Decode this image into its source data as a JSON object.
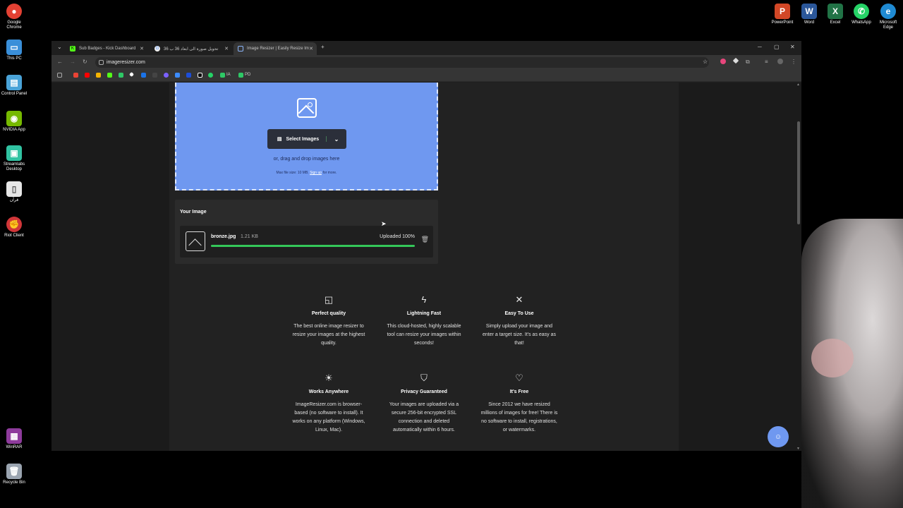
{
  "desktop": {
    "left_icons": [
      {
        "label": "Google Chrome",
        "icon": "chrome-icon",
        "color": "#e34133"
      },
      {
        "label": "This PC",
        "icon": "monitor-icon",
        "color": "#3a8fd9"
      },
      {
        "label": "Control Panel",
        "icon": "control-panel-icon",
        "color": "#4aa3d8"
      },
      {
        "label": "NVIDIA App",
        "icon": "nvidia-icon",
        "color": "#76b900"
      },
      {
        "label": "Streamlabs Desktop",
        "icon": "streamlabs-icon",
        "color": "#31c3a2"
      },
      {
        "label": "قرآن",
        "icon": "file-icon",
        "color": "#e6e6e6"
      },
      {
        "label": "Riot Client",
        "icon": "riot-icon",
        "color": "#d13639"
      },
      {
        "label": "WinRAR",
        "icon": "winrar-icon",
        "color": "#8e3b9c"
      },
      {
        "label": "Recycle Bin",
        "icon": "recycle-bin-icon",
        "color": "#9aa4b0"
      }
    ],
    "right_icons": [
      {
        "label": "PowerPoint",
        "icon": "powerpoint-icon",
        "color": "#d24726",
        "glyph": "P"
      },
      {
        "label": "Word",
        "icon": "word-icon",
        "color": "#2b579a",
        "glyph": "W"
      },
      {
        "label": "Excel",
        "icon": "excel-icon",
        "color": "#217346",
        "glyph": "X"
      },
      {
        "label": "WhatsApp",
        "icon": "whatsapp-icon",
        "color": "#25d366",
        "glyph": "✆"
      },
      {
        "label": "Microsoft Edge",
        "icon": "edge-icon",
        "color": "#1f8ad2",
        "glyph": "e"
      }
    ]
  },
  "browser": {
    "tabs": [
      {
        "title": "Sub Badges - Kick Dashboard",
        "favicon": "kick-icon",
        "active": false
      },
      {
        "title": "تحويل صورة الى ابعاد 36 ب 36",
        "favicon": "google-icon",
        "active": false
      },
      {
        "title": "Image Resizer | Easily Resize Im",
        "favicon": "image-resizer-icon",
        "active": true
      }
    ],
    "new_tab": "+",
    "url": "imageresizer.com",
    "bookmarks": [
      {
        "label": "IA"
      },
      {
        "label": "PD"
      }
    ]
  },
  "upload": {
    "select_label": "Select Images",
    "drag_hint": "or, drag and drop images here",
    "size_prefix": "Max file size: 10 MB.",
    "sign_up": "Sign up",
    "size_suffix": "for more."
  },
  "your_image": {
    "title": "Your Image",
    "file_name": "bronze.jpg",
    "file_size": "1.21 KB",
    "status": "Uploaded 100%",
    "progress": 1.0
  },
  "features": [
    {
      "icon": "image-quality-icon",
      "glyph": "◱",
      "title": "Perfect quality",
      "desc": "The best online image resizer to resize your images at the highest quality."
    },
    {
      "icon": "lightning-icon",
      "glyph": "ϟ",
      "title": "Lightning Fast",
      "desc": "This cloud-hosted, highly scalable tool can resize your images within seconds!"
    },
    {
      "icon": "tools-icon",
      "glyph": "✕",
      "title": "Easy To Use",
      "desc": "Simply upload your image and enter a target size. It's as easy as that!"
    },
    {
      "icon": "lightbulb-icon",
      "glyph": "☀",
      "title": "Works Anywhere",
      "desc": "ImageResizer.com is browser-based (no software to install). It works on any platform (Windows, Linux, Mac)."
    },
    {
      "icon": "shield-icon",
      "glyph": "⛉",
      "title": "Privacy Guaranteed",
      "desc": "Your images are uploaded via a secure 256-bit encrypted SSL connection and deleted automatically within 6 hours."
    },
    {
      "icon": "heart-icon",
      "glyph": "♡",
      "title": "It's Free",
      "desc": "Since 2012 we have resized millions of images for free! There is no software to install, registrations, or watermarks."
    }
  ],
  "colors": {
    "dropzone": "#6f98f0",
    "progress": "#34c759",
    "page_bg": "#222222"
  }
}
